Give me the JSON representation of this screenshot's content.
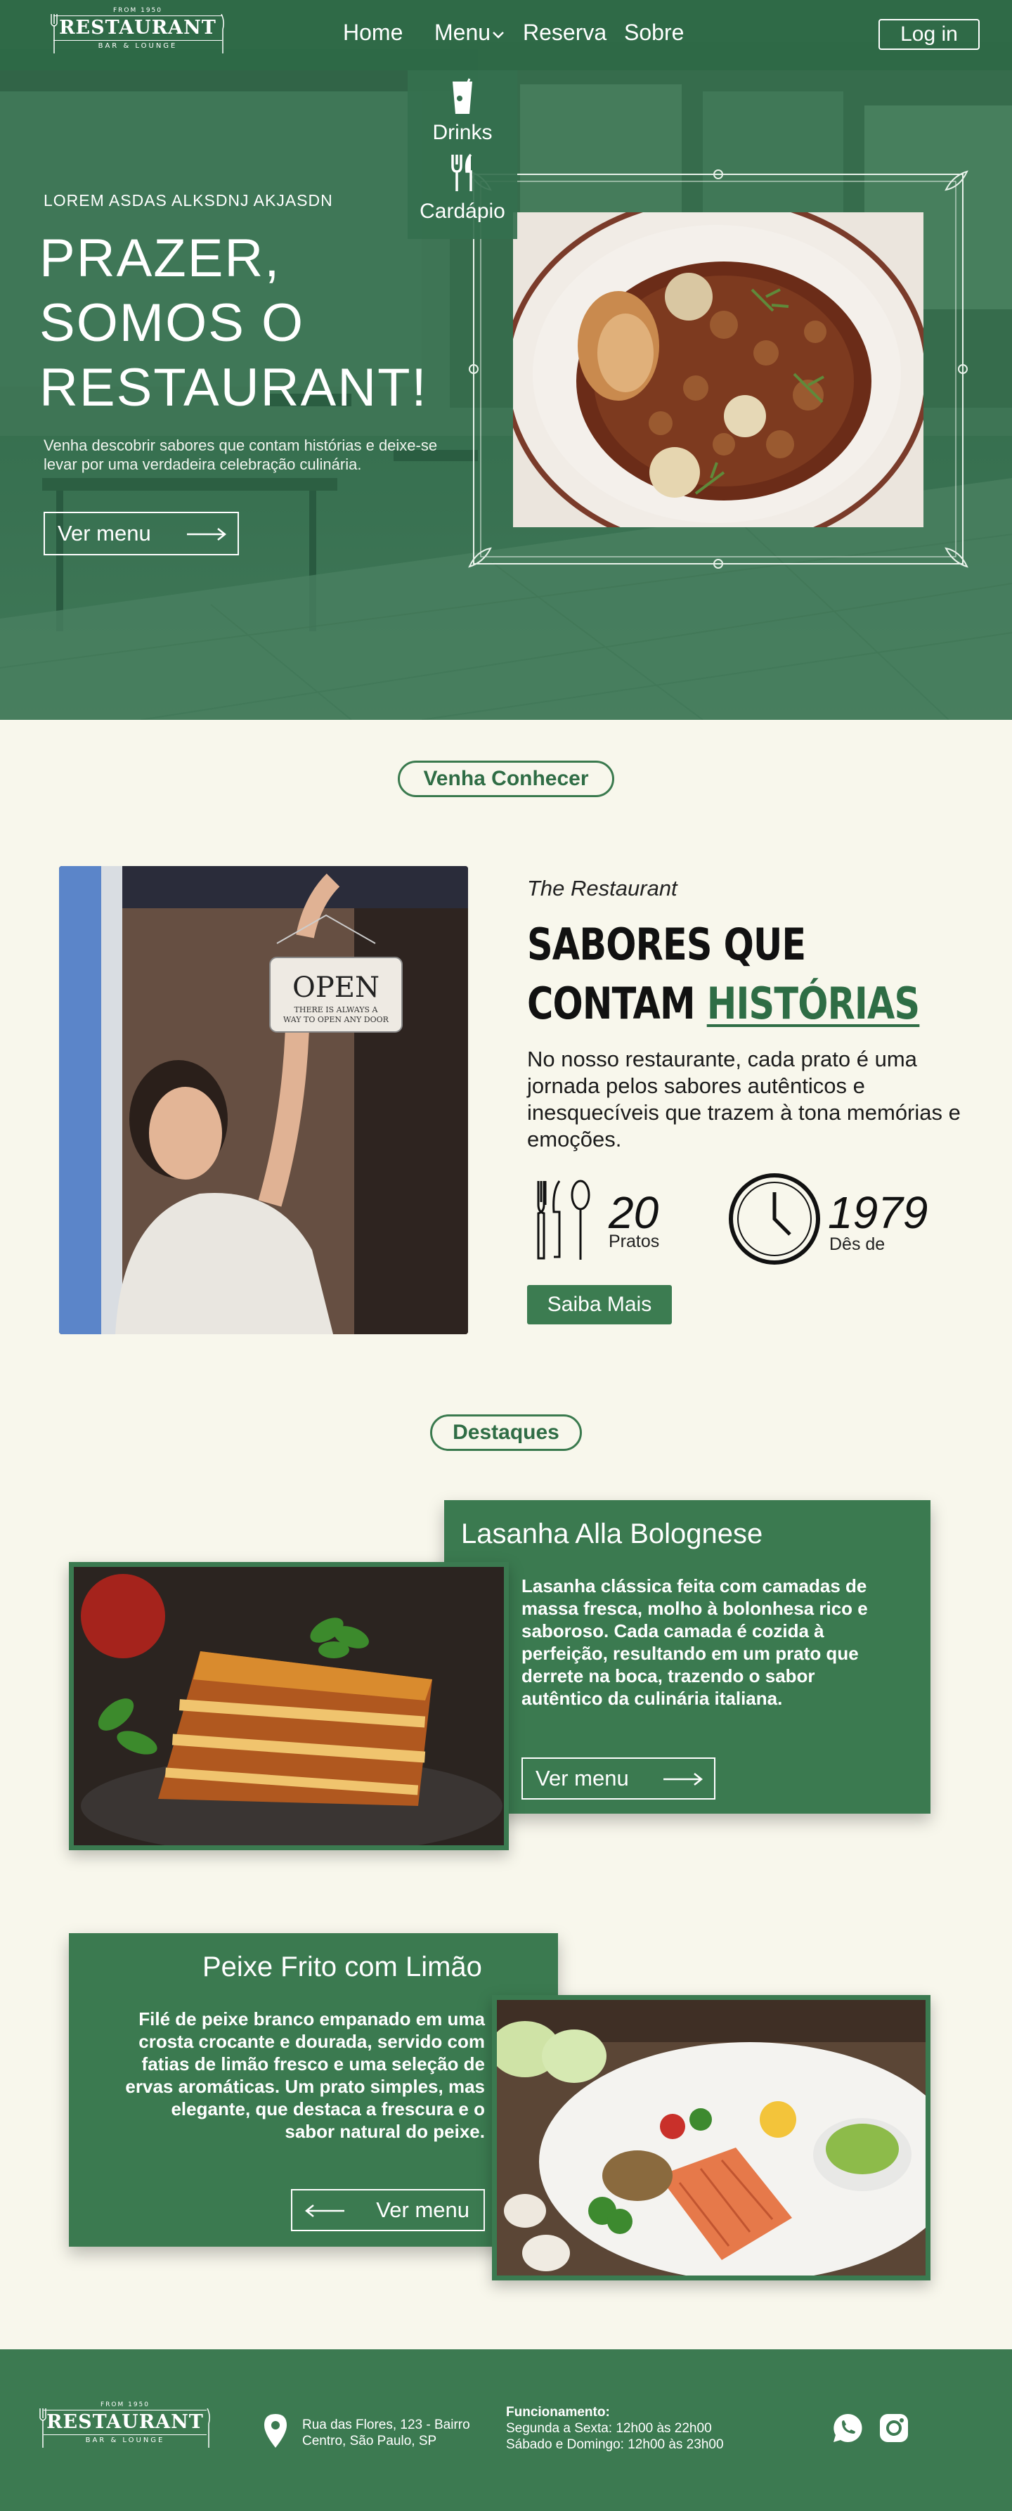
{
  "brand": {
    "name": "RESTAURANT",
    "since": "FROM 1950",
    "tagline": "BAR & LOUNGE"
  },
  "nav": {
    "home": "Home",
    "menu": "Menu",
    "reserva": "Reserva",
    "sobre": "Sobre",
    "login": "Log in",
    "dropdown": {
      "drinks": "Drinks",
      "cardapio": "Cardápio"
    }
  },
  "hero": {
    "kicker": "LOREM ASDAS ALKSDNJ AKJASDN",
    "title_line1": "PRAZER,",
    "title_line2": "SOMOS O",
    "title_line3": "RESTAURANT!",
    "text": "Venha descobrir sabores que contam histórias e deixe-se levar por uma verdadeira celebração culinária.",
    "button": "Ver menu"
  },
  "about": {
    "badge": "Venha Conhecer",
    "kicker": "The Restaurant",
    "title_line1": "SABORES QUE",
    "title_line2_a": "CONTAM ",
    "title_line2_b": "HISTÓRIAS",
    "text": "No nosso restaurante, cada prato é uma jornada pelos sabores autênticos e inesquecíveis que trazem à tona memórias e emoções.",
    "sign_text": "OPEN",
    "sign_sub1": "THERE IS ALWAYS A",
    "sign_sub2": "WAY TO OPEN ANY DOOR",
    "stats": [
      {
        "value": "20",
        "label": "Pratos",
        "icon": "cutlery-icon"
      },
      {
        "value": "1979",
        "label": "Dês de",
        "icon": "clock-icon"
      }
    ],
    "button": "Saiba Mais"
  },
  "highlights": {
    "badge": "Destaques",
    "items": [
      {
        "title": "Lasanha Alla Bolognese",
        "text": "Lasanha clássica feita com camadas de massa fresca, molho à bolonhesa rico e saboroso. Cada camada é cozida à perfeição, resultando em um prato que derrete na boca, trazendo o sabor autêntico da culinária italiana.",
        "button": "Ver menu"
      },
      {
        "title": "Peixe Frito com Limão",
        "text": "Filé de peixe branco empanado em uma crosta crocante e dourada, servido com fatias de limão fresco e uma seleção de ervas aromáticas. Um prato simples, mas elegante, que destaca a frescura e o sabor natural do peixe.",
        "button": "Ver menu"
      }
    ]
  },
  "footer": {
    "address_line1": "Rua das Flores, 123 - Bairro",
    "address_line2": "Centro, São Paulo, SP",
    "hours_title": "Funcionamento:",
    "hours_line1": "Segunda a Sexta: 12h00 às 22h00",
    "hours_line2": "Sábado e Domingo: 12h00 às 23h00",
    "social": [
      "whatsapp-icon",
      "instagram-icon"
    ]
  },
  "colors": {
    "primary_green": "#3b7a50",
    "background_cream": "#f8f7ec",
    "text_dark": "#111111"
  }
}
